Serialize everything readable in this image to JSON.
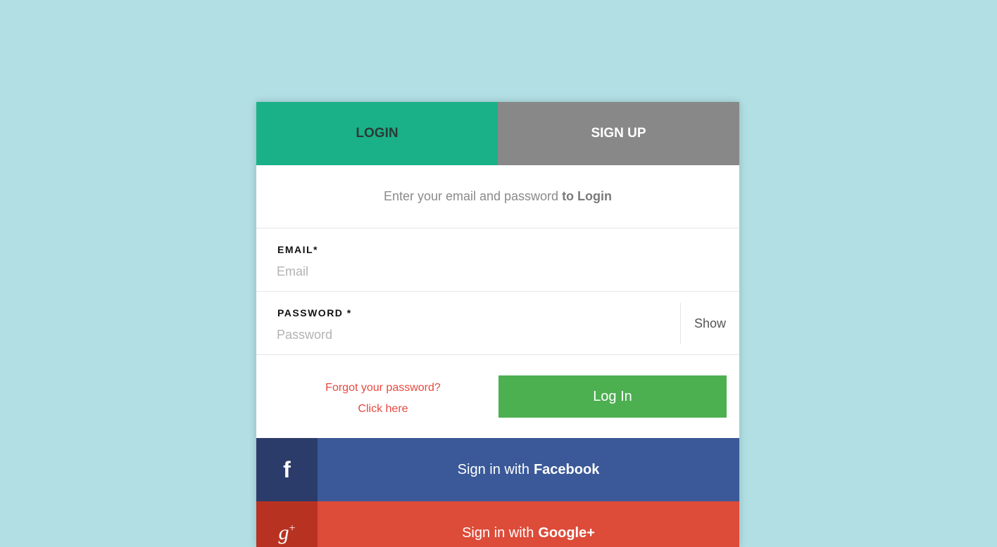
{
  "tabs": {
    "login_label": "LOGIN",
    "signup_label": "SIGN UP"
  },
  "intro": {
    "text": "Enter your email and password",
    "bold_text": "to Login"
  },
  "email": {
    "label": "EMAIL*",
    "placeholder": "Email",
    "value": ""
  },
  "password": {
    "label": "PASSWORD *",
    "placeholder": "Password",
    "value": "",
    "toggle_label": "Show"
  },
  "forgot": {
    "line1": "Forgot your password?",
    "line2": "Click here"
  },
  "login_button": {
    "label": "Log In"
  },
  "social": {
    "facebook": {
      "icon": "facebook-icon",
      "glyph": "f",
      "prefix": "Sign in with",
      "name": "Facebook"
    },
    "google": {
      "icon": "google-plus-icon",
      "glyph": "g",
      "glyph_sup": "+",
      "prefix": "Sign in with",
      "name": "Google+"
    }
  },
  "colors": {
    "background": "#b1dfe4",
    "login_tab": "#1ab188",
    "signup_tab": "#888888",
    "login_button": "#4caf50",
    "forgot_link": "#e8483f",
    "facebook": "#3b5998",
    "google": "#dd4b39"
  }
}
